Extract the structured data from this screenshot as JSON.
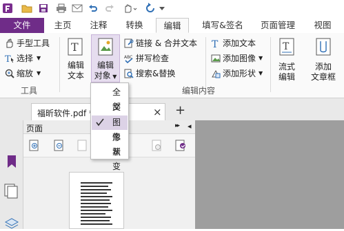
{
  "tabs": [
    {
      "label": "文件"
    },
    {
      "label": "主页"
    },
    {
      "label": "注释"
    },
    {
      "label": "转换"
    },
    {
      "label": "编辑"
    },
    {
      "label": "填写&签名"
    },
    {
      "label": "页面管理"
    },
    {
      "label": "视图"
    }
  ],
  "tools_group": {
    "hand_tool": "手型工具",
    "select": "选择",
    "zoom": "缩放",
    "group_label": "工具"
  },
  "edit_group": {
    "edit_text": [
      "编辑",
      "文本"
    ],
    "edit_object": [
      "编辑",
      "对象"
    ],
    "link_merge": "链接 & 合并文本",
    "spellcheck": "拼写检查",
    "search_replace": "搜索&替换",
    "add_text": "添加文本",
    "add_image": "添加图像",
    "add_shape": "添加形状",
    "flow_edit": [
      "流式",
      "编辑"
    ],
    "add_textbox": [
      "添加",
      "文章框"
    ],
    "group_label": "编辑内容"
  },
  "document_tab": {
    "title": "福昕软件.pdf *",
    "close": "×",
    "new_tab": "+"
  },
  "panel": {
    "title": "页面",
    "collapse": "▸▸",
    "pin": "◂"
  },
  "edit_object_menu": {
    "items": [
      {
        "label": "全部",
        "checked": false
      },
      {
        "label": "文本",
        "checked": false
      },
      {
        "label": "图像",
        "checked": true
      },
      {
        "label": "形状",
        "checked": false
      },
      {
        "label": "渐变",
        "checked": false
      }
    ]
  },
  "colors": {
    "brand_purple": "#6f2c88",
    "accent_blue": "#2f6fb5",
    "selected_item_bg": "#dcd2e6"
  }
}
